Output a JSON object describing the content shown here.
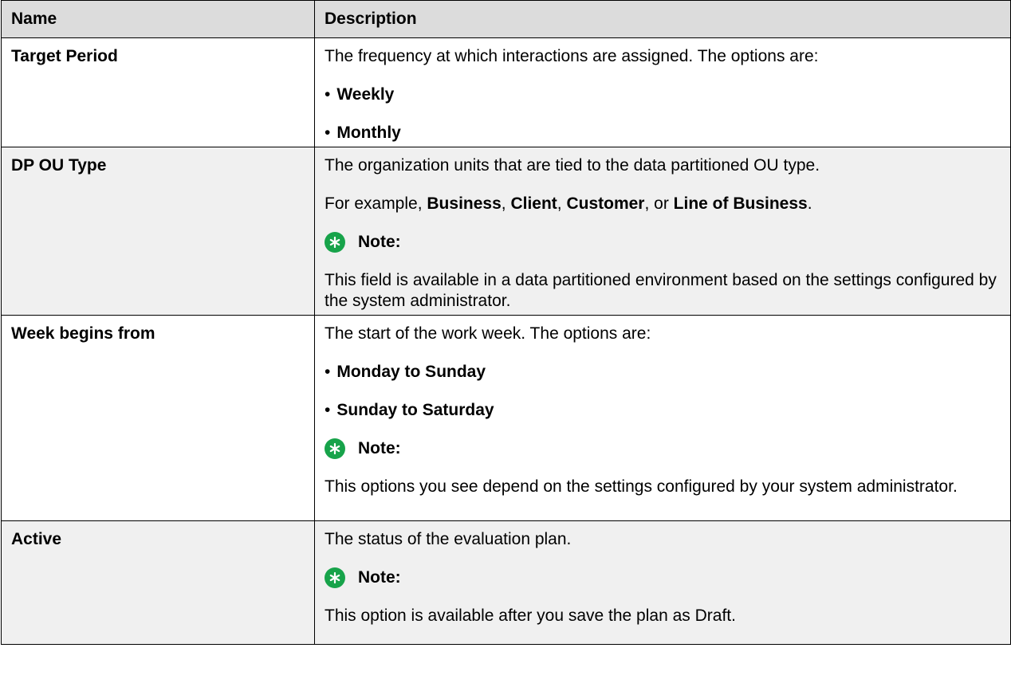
{
  "header": {
    "name": "Name",
    "description": "Description"
  },
  "rows": [
    {
      "name": "Target Period",
      "intro": "The frequency at which interactions are assigned. The options are:",
      "options": [
        "Weekly",
        "Monthly"
      ]
    },
    {
      "name": "DP OU Type",
      "intro": "The organization units that are tied to the data partitioned OU type.",
      "example_prefix": "For example, ",
      "examples": [
        "Business",
        "Client",
        "Customer",
        "Line of Business"
      ],
      "example_seps": [
        ", ",
        ", ",
        ", or ",
        "."
      ],
      "note_label": "Note:",
      "note_text": "This field is available in a data partitioned environment based on the settings configured by the system administrator."
    },
    {
      "name": "Week begins from",
      "intro": "The start of the work week. The options are:",
      "options": [
        "Monday to Sunday",
        "Sunday to Saturday"
      ],
      "note_label": "Note:",
      "note_text": "This options you see depend on the settings configured by your system administrator."
    },
    {
      "name": "Active",
      "intro": "The status of the evaluation plan.",
      "note_label": "Note:",
      "note_text": "This option is available after you save the plan as Draft."
    }
  ],
  "icons": {
    "note": "star-note-icon"
  },
  "colors": {
    "note_icon": "#17a34a",
    "header_bg": "#dcdcdc",
    "alt_row_bg": "#f0f0f0"
  }
}
